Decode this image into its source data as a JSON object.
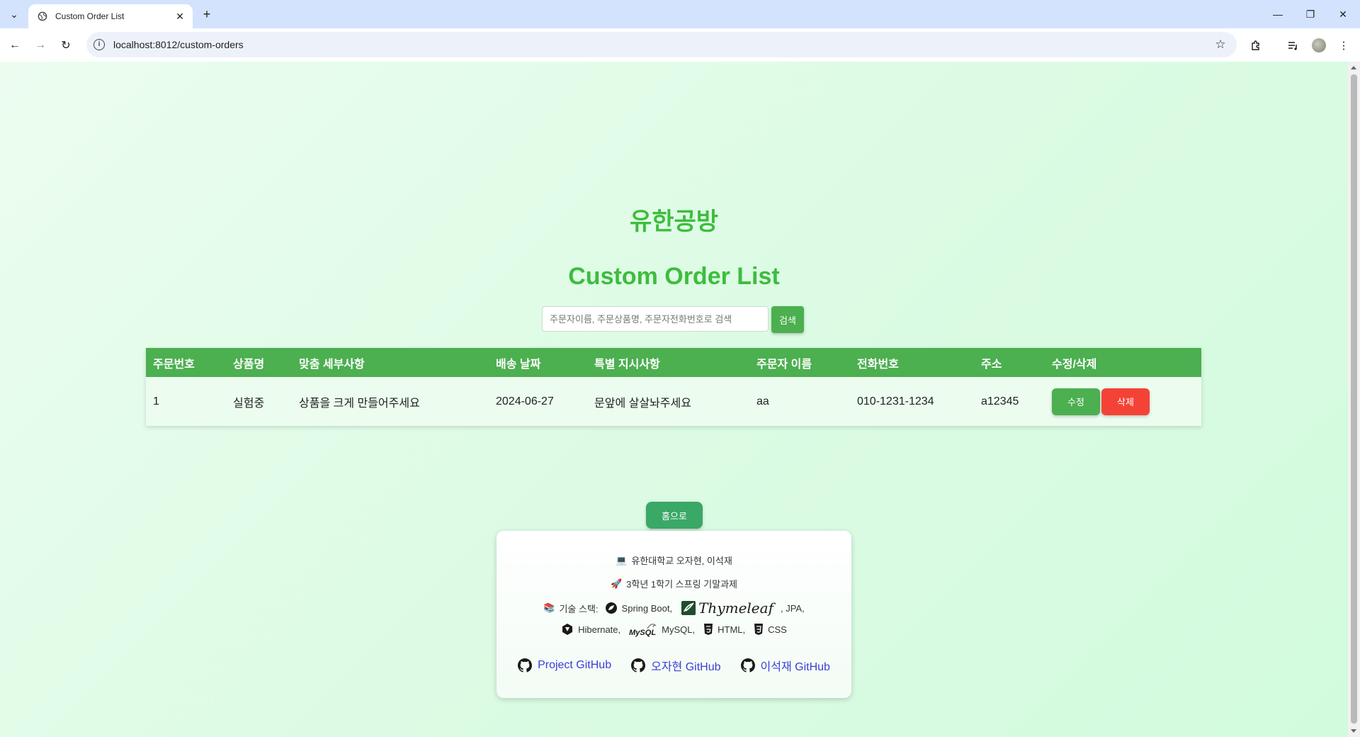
{
  "browser": {
    "tab_title": "Custom Order List",
    "url": "localhost:8012/custom-orders"
  },
  "page": {
    "site_title": "유한공방",
    "heading": "Custom Order List",
    "search": {
      "placeholder": "주문자이름, 주문상품명, 주문자전화번호로 검색",
      "value": "",
      "button_label": "검색"
    },
    "table": {
      "headers": [
        "주문번호",
        "상품명",
        "맞춤 세부사항",
        "배송 날짜",
        "특별 지시사항",
        "주문자 이름",
        "전화번호",
        "주소",
        "수정/삭제"
      ],
      "rows": [
        {
          "order_no": "1",
          "product": "실험중",
          "details": "상품을 크게 만들어주세요",
          "delivery_date": "2024-06-27",
          "instructions": "문앞에 살살놔주세요",
          "customer": "aa",
          "phone": "010-1231-1234",
          "address": "a12345",
          "edit_label": "수정",
          "delete_label": "삭제"
        }
      ]
    },
    "home_button": "홈으로",
    "footer": {
      "authors": "유한대학교 오자현, 이석재",
      "course": "3학년 1학기 스프링 기말과제",
      "stack_label": "기술 스택:",
      "stack": {
        "spring": "Spring Boot,",
        "thymeleaf": "Thymeleaf",
        "jpa": ", JPA,",
        "hibernate": "Hibernate,",
        "mysql_logo": "MySQL",
        "mysql": "MySQL,",
        "html": "HTML,",
        "css": "CSS"
      },
      "links": [
        {
          "label": "Project GitHub"
        },
        {
          "label": "오자현 GitHub"
        },
        {
          "label": "이석재 GitHub"
        }
      ]
    }
  },
  "colors": {
    "accent_green": "#3dbd3d",
    "table_header": "#4caf50",
    "delete_red": "#f44336",
    "link_blue": "#3a3fd6"
  },
  "icons": [
    "globe-icon",
    "close-icon",
    "plus-icon",
    "back-arrow-icon",
    "forward-arrow-icon",
    "reload-icon",
    "info-icon",
    "star-icon",
    "extensions-icon",
    "media-icon",
    "kebab-menu-icon",
    "laptop-icon",
    "rocket-icon",
    "books-icon",
    "spring-icon",
    "thymeleaf-icon",
    "hibernate-icon",
    "mysql-icon",
    "html5-icon",
    "css3-icon",
    "github-icon"
  ]
}
